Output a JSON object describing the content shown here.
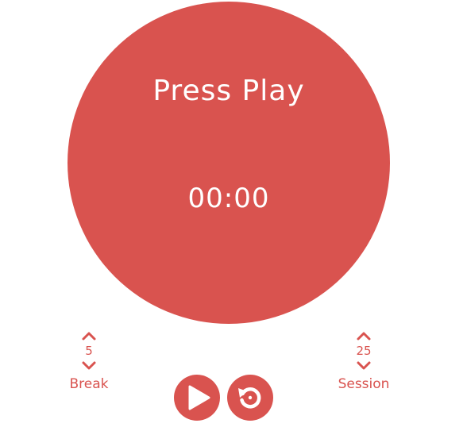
{
  "timer": {
    "status": "Press Play",
    "time": "00:00"
  },
  "break_control": {
    "value": "5",
    "label": "Break"
  },
  "session_control": {
    "value": "25",
    "label": "Session"
  },
  "icons": {
    "increment": "chevron-up-icon",
    "decrement": "chevron-down-icon",
    "play": "play-icon",
    "reset": "reset-icon"
  },
  "colors": {
    "accent": "#d9534f",
    "text_on_accent": "#ffffff",
    "background": "#ffffff"
  }
}
